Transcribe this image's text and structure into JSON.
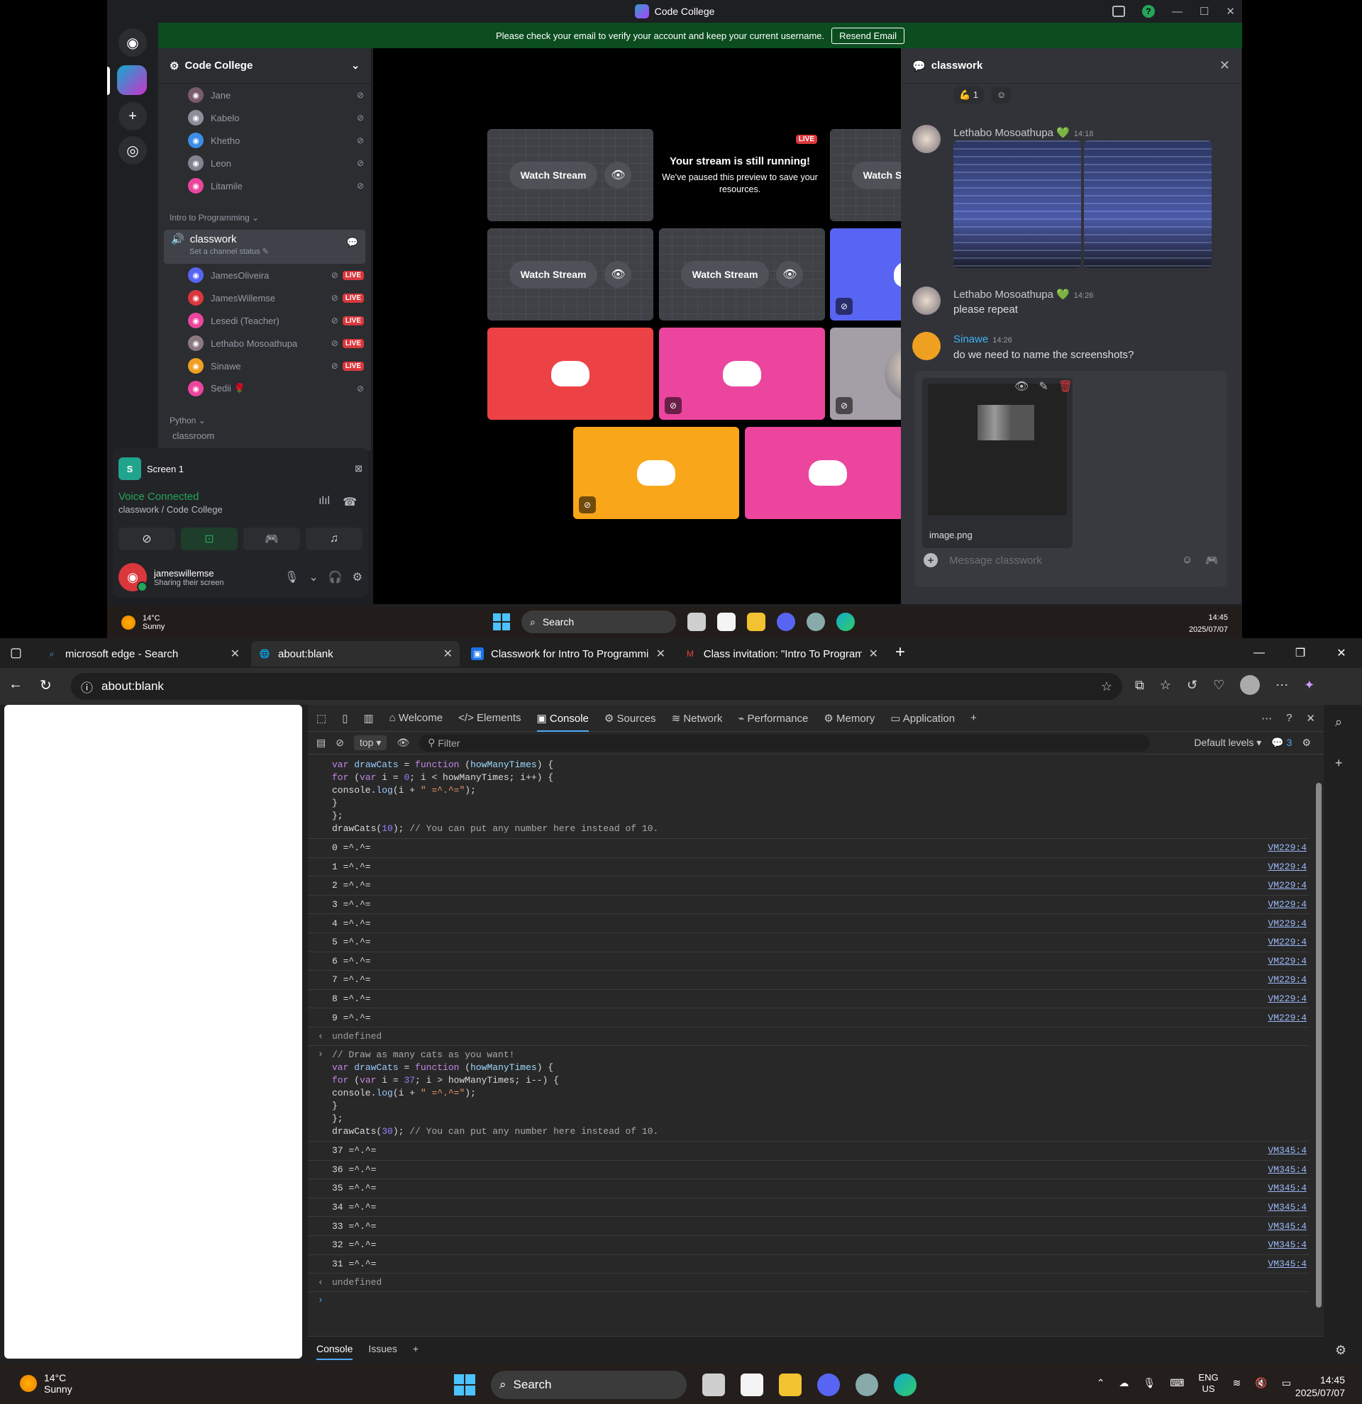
{
  "discord": {
    "window_title": "Code College",
    "banner": {
      "text": "Please check your email to verify your account and keep your current username.",
      "button": "Resend Email"
    },
    "server_name": "Code College",
    "voice_users_top": [
      {
        "name": "Jane",
        "color": "#7a5a6e"
      },
      {
        "name": "Kabelo",
        "color": "#8a8f99"
      },
      {
        "name": "Khetho",
        "color": "#3a8ee6"
      },
      {
        "name": "Leon",
        "color": "#80848e"
      },
      {
        "name": "Litamile",
        "color": "#eb459e"
      }
    ],
    "category_intro": "Intro to Programming ⌄",
    "active_channel": {
      "name": "classwork",
      "status": "Set a channel status ✎"
    },
    "voice_users_classwork": [
      {
        "name": "JamesOliveira",
        "color": "#5865f2",
        "live": "LIVE"
      },
      {
        "name": "JamesWillemse",
        "color": "#da373c",
        "live": "LIVE"
      },
      {
        "name": "Lesedi (Teacher)",
        "color": "#eb459e",
        "live": "LIVE"
      },
      {
        "name": "Lethabo Mosoathupa",
        "color": "#8a7a80",
        "live": "LIVE"
      },
      {
        "name": "Sinawe",
        "color": "#f0a020",
        "live": "LIVE"
      },
      {
        "name": "Sedii 🌹",
        "color": "#eb459e",
        "live": ""
      }
    ],
    "category_python": "Python ⌄",
    "python_partial": "classroom",
    "screen_share": {
      "icon_letter": "S",
      "label": "Screen 1"
    },
    "voice": {
      "status": "Voice Connected",
      "channel": "classwork / Code College"
    },
    "user": {
      "name": "jameswillemse",
      "status": "Sharing their screen"
    },
    "stage": {
      "watch_label": "Watch Stream",
      "live_badge": "LIVE",
      "paused_title": "Your stream is still running!",
      "paused_text": "We've paused this preview to save your resources."
    },
    "chat": {
      "channel": "classwork",
      "reactions": [
        "💪 1",
        "☺"
      ],
      "messages": [
        {
          "author": "Lethabo Mosoathupa 💚",
          "time": "14:18",
          "text": ""
        },
        {
          "author": "Lethabo Mosoathupa 💚",
          "time": "14:26",
          "text": "please repeat"
        },
        {
          "author": "Sinawe",
          "time": "14:26",
          "text": "do we need to name the screenshots?"
        }
      ],
      "attachment_name": "image.png",
      "input_placeholder": "Message classwork"
    },
    "taskbar": {
      "temp": "14°C",
      "weather": "Sunny",
      "search": "Search",
      "time": "14:45",
      "date": "2025/07/07"
    }
  },
  "edge": {
    "tabs": [
      {
        "title": "microsoft edge - Search",
        "icon": "search-icon"
      },
      {
        "title": "about:blank",
        "icon": "globe-icon"
      },
      {
        "title": "Classwork for Intro To Programmi",
        "icon": "classroom-icon"
      },
      {
        "title": "Class invitation: \"Intro To Program",
        "icon": "gmail-icon"
      }
    ],
    "url": "about:blank",
    "devtools_tabs": [
      "Welcome",
      "Elements",
      "Console",
      "Sources",
      "Network",
      "Performance",
      "Memory",
      "Application"
    ],
    "context": "top",
    "filter_placeholder": "Filter",
    "levels": "Default levels",
    "issues_count": "3",
    "run1": {
      "code": [
        "var drawCats = function (howManyTimes) {",
        "for (var i = 0; i < howManyTimes; i++) {",
        "console.log(i + \" =^.^=\");",
        "}",
        "};",
        "drawCats(10); // You can put any number here instead of 10."
      ],
      "outputs": [
        "0 =^.^=",
        "1 =^.^=",
        "2 =^.^=",
        "3 =^.^=",
        "4 =^.^=",
        "5 =^.^=",
        "6 =^.^=",
        "7 =^.^=",
        "8 =^.^=",
        "9 =^.^="
      ],
      "source": "VM229:4",
      "result": "undefined"
    },
    "run2": {
      "code": [
        "// Draw as many cats as you want!",
        "var drawCats = function (howManyTimes) {",
        "for (var i = 37; i > howManyTimes; i--) {",
        "console.log(i + \" =^.^=\");",
        "}",
        "};",
        "drawCats(30); // You can put any number here instead of 10."
      ],
      "outputs": [
        "37 =^.^=",
        "36 =^.^=",
        "35 =^.^=",
        "34 =^.^=",
        "33 =^.^=",
        "32 =^.^=",
        "31 =^.^="
      ],
      "source": "VM345:4",
      "result": "undefined"
    },
    "drawer_tabs": [
      "Console",
      "Issues"
    ]
  },
  "taskbar": {
    "temp": "14°C",
    "weather": "Sunny",
    "search": "Search",
    "lang1": "ENG",
    "lang2": "US",
    "time": "14:45",
    "date": "2025/07/07"
  }
}
